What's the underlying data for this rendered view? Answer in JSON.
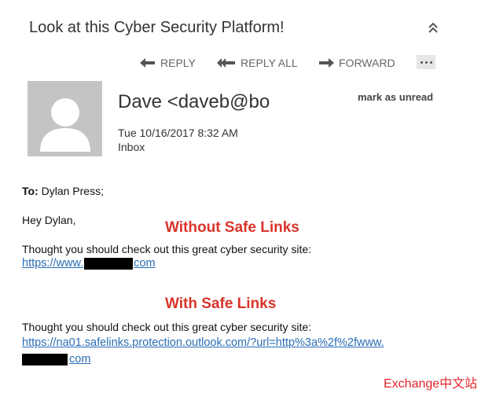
{
  "message": {
    "subject": "Look at this Cyber Security Platform!",
    "sender": "Dave <daveb@bo",
    "date": "Tue 10/16/2017 8:32 AM",
    "folder": "Inbox",
    "mark_unread_label": "mark as unread"
  },
  "toolbar": {
    "reply_label": "REPLY",
    "reply_all_label": "REPLY ALL",
    "forward_label": "FORWARD"
  },
  "recipients": {
    "to_label": "To:",
    "to_value": "Dylan Press;"
  },
  "body": {
    "greeting": "Hey Dylan,",
    "caption_without": "Without Safe Links",
    "line_without": "Thought you should check out this great cyber security site:",
    "link_without_prefix": "https://www.",
    "link_without_suffix": "com",
    "caption_with": "With Safe Links",
    "line_with": "Thought you should check out this great cyber security site:",
    "link_with_line1": "https://na01.safelinks.protection.outlook.com/?url=http%3a%2f%2fwww.",
    "link_with_suffix": "com"
  },
  "watermark": "Exchange中文站",
  "colors": {
    "caption": "#d9342b",
    "link": "#2a6db5",
    "watermark": "#e3242b",
    "avatar": "#c4c4c4"
  }
}
